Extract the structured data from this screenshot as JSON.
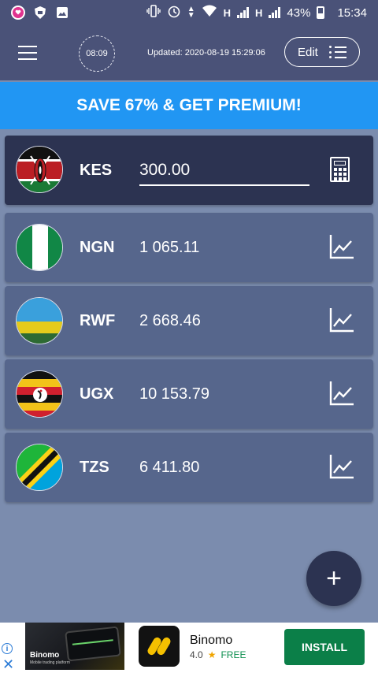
{
  "status_bar": {
    "battery": "43%",
    "time": "15:34",
    "network_1": "H",
    "network_2": "H"
  },
  "app_bar": {
    "timer": "08:09",
    "updated_text": "Updated: 2020-08-19 15:29:06",
    "edit_label": "Edit"
  },
  "promo": {
    "text": "SAVE 67% & GET PREMIUM!"
  },
  "base_currency": {
    "code": "KES",
    "amount": "300.00",
    "flag": "kenya-flag"
  },
  "rates": [
    {
      "code": "NGN",
      "value": "1 065.11",
      "flag": "nigeria-flag"
    },
    {
      "code": "RWF",
      "value": "2 668.46",
      "flag": "rwanda-flag"
    },
    {
      "code": "UGX",
      "value": "10 153.79",
      "flag": "uganda-flag"
    },
    {
      "code": "TZS",
      "value": "6 411.80",
      "flag": "tanzania-flag"
    }
  ],
  "fab": {
    "label": "+"
  },
  "ad": {
    "thumb_brand": "Binomo",
    "thumb_subtitle": "Mobile trading platform",
    "title": "Binomo",
    "rating": "4.0",
    "price": "FREE",
    "install_label": "INSTALL"
  },
  "colors": {
    "app_bar": "#4a5278",
    "promo": "#2196f3",
    "card": "#56668c",
    "base_card": "#2c3351",
    "install": "#0b7f48"
  }
}
